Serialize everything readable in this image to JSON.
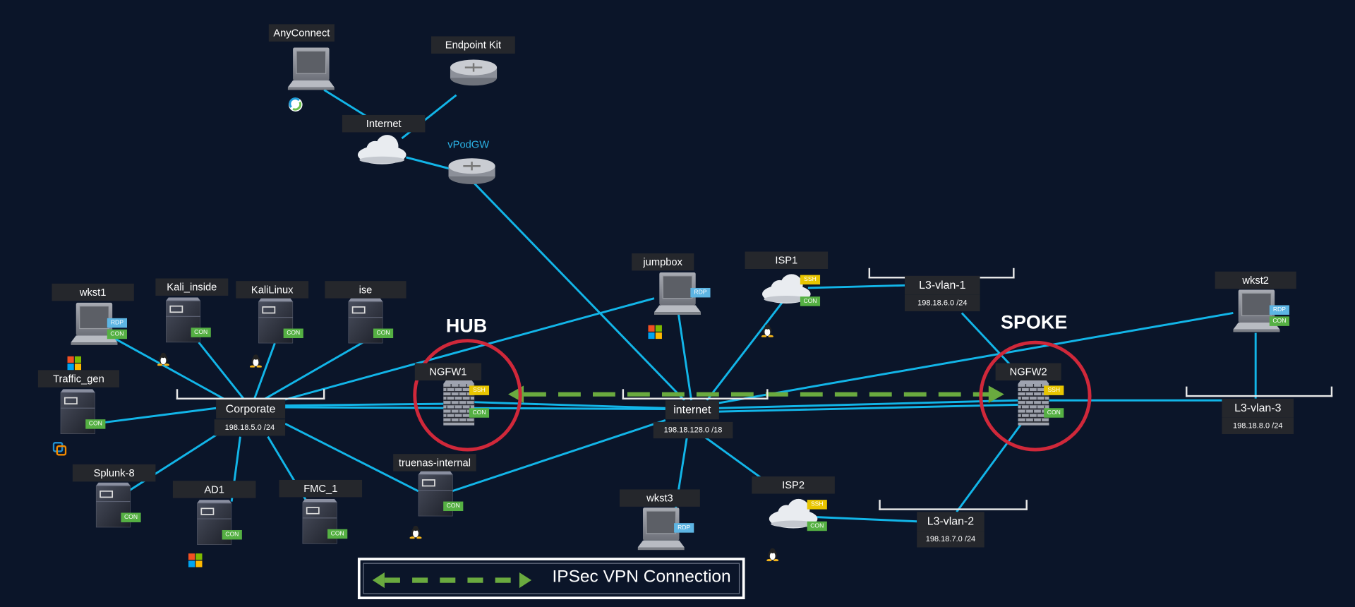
{
  "colors": {
    "background": "#0b1529",
    "link": "#12b5e8",
    "vpn": "#6aaa3f",
    "highlight": "#d0283a",
    "label_bg": "#25272c"
  },
  "zones": {
    "hub": "HUB",
    "spoke": "SPOKE"
  },
  "vpodgw": "vPodGW",
  "legend": {
    "label": "IPSec VPN Connection"
  },
  "nodes": [
    {
      "id": "anyconnect",
      "label": "AnyConnect",
      "type": "laptop",
      "tags": [],
      "os": "anyconnect-icon"
    },
    {
      "id": "endpointkit",
      "label": "Endpoint Kit",
      "type": "router",
      "tags": [],
      "os": null
    },
    {
      "id": "internet_top",
      "label": "Internet",
      "type": "cloud",
      "tags": [],
      "os": null
    },
    {
      "id": "vpodgw",
      "label": "",
      "type": "router",
      "tags": [],
      "os": null
    },
    {
      "id": "jumpbox",
      "label": "jumpbox",
      "type": "laptop",
      "tags": [
        "RDP"
      ],
      "os": "windows-icon"
    },
    {
      "id": "isp1",
      "label": "ISP1",
      "type": "cloud",
      "tags": [
        "SSH",
        "CON"
      ],
      "os": "linux-icon"
    },
    {
      "id": "wkst2",
      "label": "wkst2",
      "type": "laptop",
      "tags": [
        "RDP",
        "CON"
      ],
      "os": null
    },
    {
      "id": "ngfw1",
      "label": "NGFW1",
      "type": "firewall",
      "tags": [
        "SSH",
        "CON"
      ],
      "os": null
    },
    {
      "id": "ngfw2",
      "label": "NGFW2",
      "type": "firewall",
      "tags": [
        "SSH",
        "CON"
      ],
      "os": null
    },
    {
      "id": "wkst1",
      "label": "wkst1",
      "type": "laptop",
      "tags": [
        "RDP",
        "CON"
      ],
      "os": "windows-icon"
    },
    {
      "id": "kali_inside",
      "label": "Kali_inside",
      "type": "server",
      "tags": [
        "CON"
      ],
      "os": "linux-icon"
    },
    {
      "id": "kalilinux",
      "label": "KaliLinux",
      "type": "server",
      "tags": [
        "CON"
      ],
      "os": "linux-icon"
    },
    {
      "id": "ise",
      "label": "ise",
      "type": "server",
      "tags": [
        "CON"
      ],
      "os": null
    },
    {
      "id": "traffic_gen",
      "label": "Traffic_gen",
      "type": "server",
      "tags": [
        "CON"
      ],
      "os": "vmware-icon"
    },
    {
      "id": "splunk8",
      "label": "Splunk-8",
      "type": "server",
      "tags": [
        "CON"
      ],
      "os": null
    },
    {
      "id": "ad1",
      "label": "AD1",
      "type": "server",
      "tags": [
        "CON"
      ],
      "os": "windows-icon"
    },
    {
      "id": "fmc1",
      "label": "FMC_1",
      "type": "server",
      "tags": [
        "CON"
      ],
      "os": null
    },
    {
      "id": "truenas",
      "label": "truenas-internal",
      "type": "server",
      "tags": [
        "CON"
      ],
      "os": "linux-icon"
    },
    {
      "id": "wkst3",
      "label": "wkst3",
      "type": "laptop",
      "tags": [
        "RDP"
      ],
      "os": null
    },
    {
      "id": "isp2",
      "label": "ISP2",
      "type": "cloud",
      "tags": [
        "SSH",
        "CON"
      ],
      "os": "linux-icon"
    }
  ],
  "networks": [
    {
      "id": "corporate",
      "label": "Corporate",
      "subnet": "198.18.5.0 /24"
    },
    {
      "id": "internet",
      "label": "internet",
      "subnet": "198.18.128.0 /18"
    },
    {
      "id": "vlan1",
      "label": "L3-vlan-1",
      "subnet": "198.18.6.0 /24"
    },
    {
      "id": "vlan2",
      "label": "L3-vlan-2",
      "subnet": "198.18.7.0 /24"
    },
    {
      "id": "vlan3",
      "label": "L3-vlan-3",
      "subnet": "198.18.8.0 /24"
    }
  ],
  "vpn": {
    "from": "ngfw1",
    "to": "ngfw2",
    "bidirectional": true
  }
}
